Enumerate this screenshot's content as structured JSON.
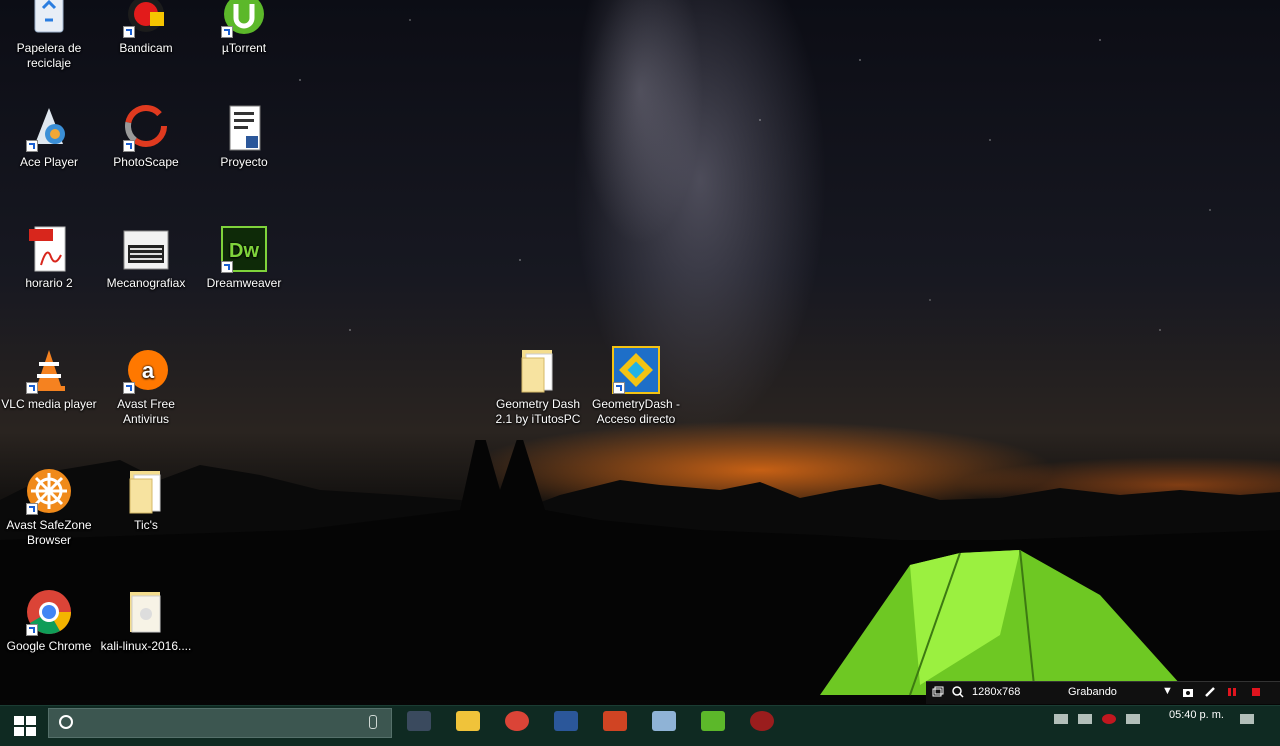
{
  "desktop": {
    "icons": [
      {
        "label": "Papelera de reciclaje",
        "icon": "recycle-bin-icon"
      },
      {
        "label": "Bandicam",
        "icon": "bandicam-icon"
      },
      {
        "label": "µTorrent",
        "icon": "utorrent-icon"
      },
      {
        "label": "Ace Player",
        "icon": "ace-player-icon"
      },
      {
        "label": "PhotoScape",
        "icon": "photoscape-icon"
      },
      {
        "label": "Proyecto",
        "icon": "word-document-icon"
      },
      {
        "label": "horario 2",
        "icon": "pdf-icon"
      },
      {
        "label": "Mecanografiax",
        "icon": "keyboard-icon"
      },
      {
        "label": "Dreamweaver",
        "icon": "dreamweaver-icon"
      },
      {
        "label": "VLC media player",
        "icon": "vlc-icon"
      },
      {
        "label": "Avast Free Antivirus",
        "icon": "avast-icon"
      },
      {
        "label": "Avast SafeZone Browser",
        "icon": "safezone-browser-icon"
      },
      {
        "label": "Tic's",
        "icon": "folder-icon"
      },
      {
        "label": "Google Chrome",
        "icon": "chrome-icon"
      },
      {
        "label": "kali-linux-2016....",
        "icon": "file-icon"
      },
      {
        "label": "Geometry Dash 2.1 by iTutosPC",
        "icon": "folder-icon"
      },
      {
        "label": "GeometryDash - Acceso directo",
        "icon": "geometry-dash-icon"
      }
    ]
  },
  "recording_toolbar": {
    "resolution": "1280x768",
    "status": "Grabando"
  },
  "taskbar": {
    "clock_time": "05:40 p. m.",
    "apps": [
      "store-icon",
      "file-explorer-icon",
      "chrome-icon",
      "word-icon",
      "powerpoint-icon",
      "notepad-icon",
      "utorrent-icon",
      "bandicam-icon"
    ]
  },
  "colors": {
    "taskbar_bg": "#0f2a22",
    "search_bg": "#3c5650",
    "tent_green": "#7be02a",
    "horizon_orange": "#ff7a14"
  }
}
